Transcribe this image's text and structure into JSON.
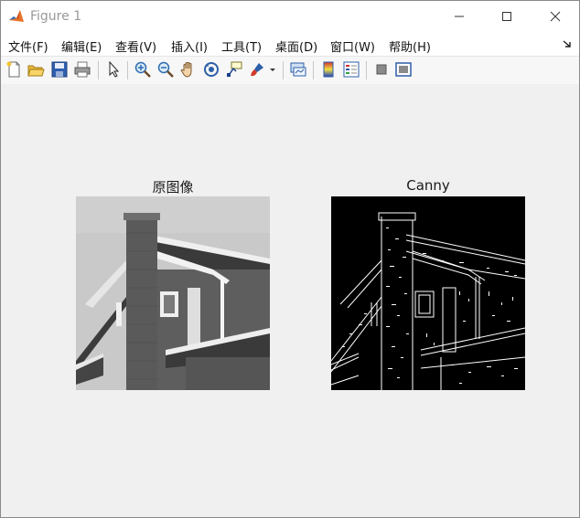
{
  "window": {
    "title": "Figure 1"
  },
  "menu": {
    "items": [
      {
        "label": "文件(F)"
      },
      {
        "label": "编辑(E)"
      },
      {
        "label": "查看(V)"
      },
      {
        "label": "插入(I)"
      },
      {
        "label": "工具(T)"
      },
      {
        "label": "桌面(D)"
      },
      {
        "label": "窗口(W)"
      },
      {
        "label": "帮助(H)"
      }
    ]
  },
  "toolbar": {
    "icons": [
      "new-figure-icon",
      "open-file-icon",
      "save-icon",
      "print-icon",
      "select-arrow-icon",
      "zoom-in-icon",
      "zoom-out-icon",
      "pan-hand-icon",
      "rotate-3d-icon",
      "data-cursor-icon",
      "brush-icon",
      "brush-dropdown-icon",
      "link-plot-icon",
      "colorbar-icon",
      "legend-icon",
      "hide-plot-tools-icon",
      "show-plot-tools-icon"
    ]
  },
  "axes": [
    {
      "title": "原图像",
      "image": "grayscale house photograph"
    },
    {
      "title": "Canny",
      "image": "canny edge map"
    }
  ],
  "colors": {
    "titlebar": "#ffffff",
    "canvas": "#f0f0f0",
    "edge_bg": "#000000",
    "edge_fg": "#ffffff"
  }
}
